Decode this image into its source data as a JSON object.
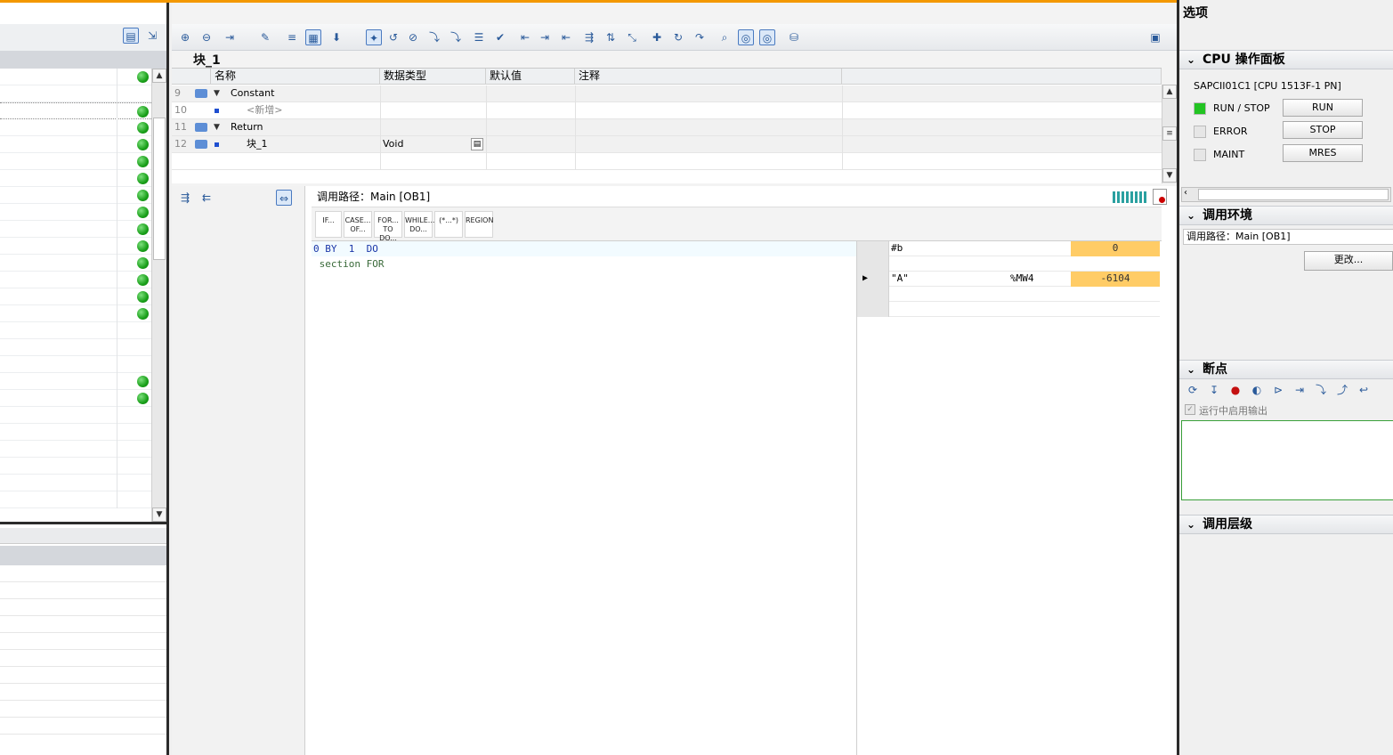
{
  "editor": {
    "block_title": "块_1",
    "columns": [
      "名称",
      "数据类型",
      "默认值",
      "注释"
    ],
    "rows": [
      {
        "num": "9",
        "name": "Constant",
        "type": "",
        "kind": "section"
      },
      {
        "num": "10",
        "name": "<新增>",
        "type": "",
        "kind": "add"
      },
      {
        "num": "11",
        "name": "Return",
        "type": "",
        "kind": "section"
      },
      {
        "num": "12",
        "name": "块_1",
        "type": "Void",
        "kind": "var"
      }
    ]
  },
  "code": {
    "call_path": "调用路径：Main [OB1]",
    "scl_buttons": [
      "IF...",
      "CASE... OF...",
      "FOR... TO DO...",
      "WHILE... DO...",
      "(*...*)",
      "REGION"
    ],
    "lines": [
      "0 BY  1  DO",
      " section FOR"
    ]
  },
  "watch": {
    "rows": [
      {
        "name": "#b",
        "addr": "",
        "value": "0"
      },
      {
        "name": "\"A\"",
        "addr": "%MW4",
        "value": "-6104"
      }
    ]
  },
  "right": {
    "options_title": "选项",
    "cpu_panel_title": "CPU 操作面板",
    "cpu_name": "SAPCII01C1 [CPU 1513F-1 PN]",
    "leds": [
      {
        "label": "RUN / STOP",
        "button": "RUN",
        "color": "#22c422"
      },
      {
        "label": "ERROR",
        "button": "STOP",
        "color": "#e6e6e6"
      },
      {
        "label": "MAINT",
        "button": "MRES",
        "color": "#e6e6e6"
      }
    ],
    "call_env_title": "调用环境",
    "call_env_path": "调用路径：Main [OB1]",
    "change_button": "更改...",
    "breakpoints_title": "断点",
    "run_output_label": "运行中启用输出",
    "call_hierarchy_title": "调用层级"
  },
  "colors": {
    "accent": "#f39800",
    "watch_value_bg": "#ffcc66",
    "status_ok": "#1aa01a"
  }
}
